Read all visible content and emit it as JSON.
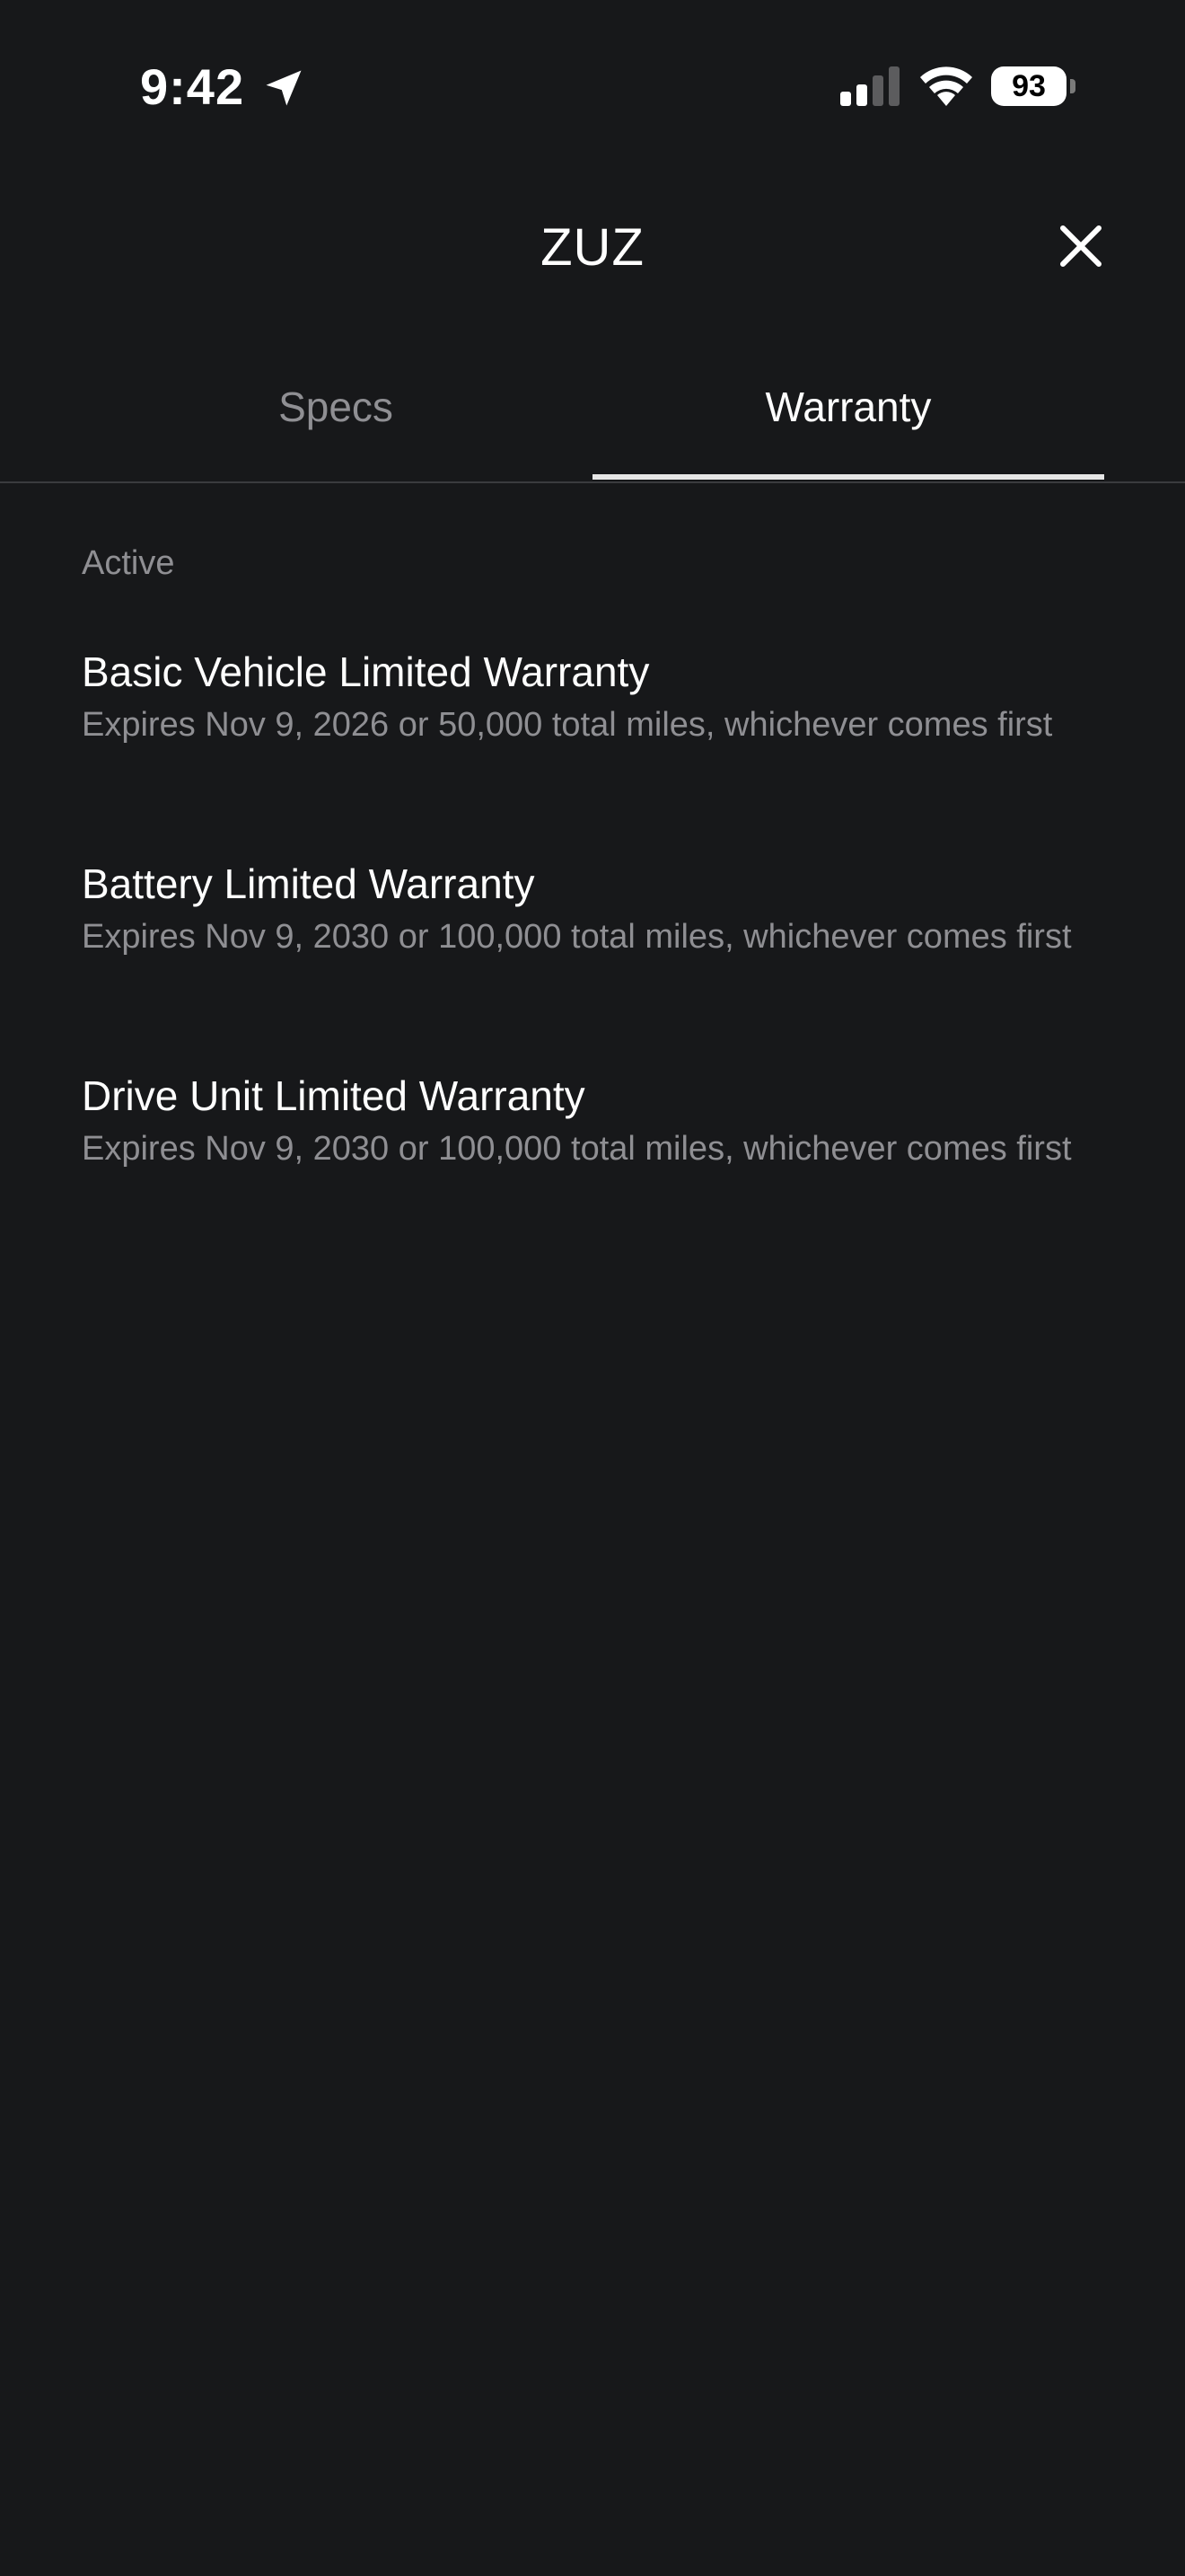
{
  "status_bar": {
    "time": "9:42",
    "battery_level": "93"
  },
  "header": {
    "title": "ZUZ"
  },
  "tabs": [
    {
      "label": "Specs",
      "active": false
    },
    {
      "label": "Warranty",
      "active": true
    }
  ],
  "section": {
    "label": "Active"
  },
  "warranties": [
    {
      "title": "Basic Vehicle Limited Warranty",
      "description": "Expires Nov 9, 2026 or 50,000 total miles, whichever comes first"
    },
    {
      "title": "Battery Limited Warranty",
      "description": "Expires Nov 9, 2030 or 100,000 total miles, whichever comes first"
    },
    {
      "title": "Drive Unit Limited Warranty",
      "description": "Expires Nov 9, 2030 or 100,000 total miles, whichever comes first"
    }
  ],
  "colors": {
    "background": "#17181a",
    "text_primary": "#ffffff",
    "text_secondary": "#8f8f93",
    "divider": "#3a3b3e"
  },
  "icons": {
    "location": "location-arrow-icon",
    "signal": "cellular-signal-icon",
    "wifi": "wifi-icon",
    "close": "close-icon"
  }
}
